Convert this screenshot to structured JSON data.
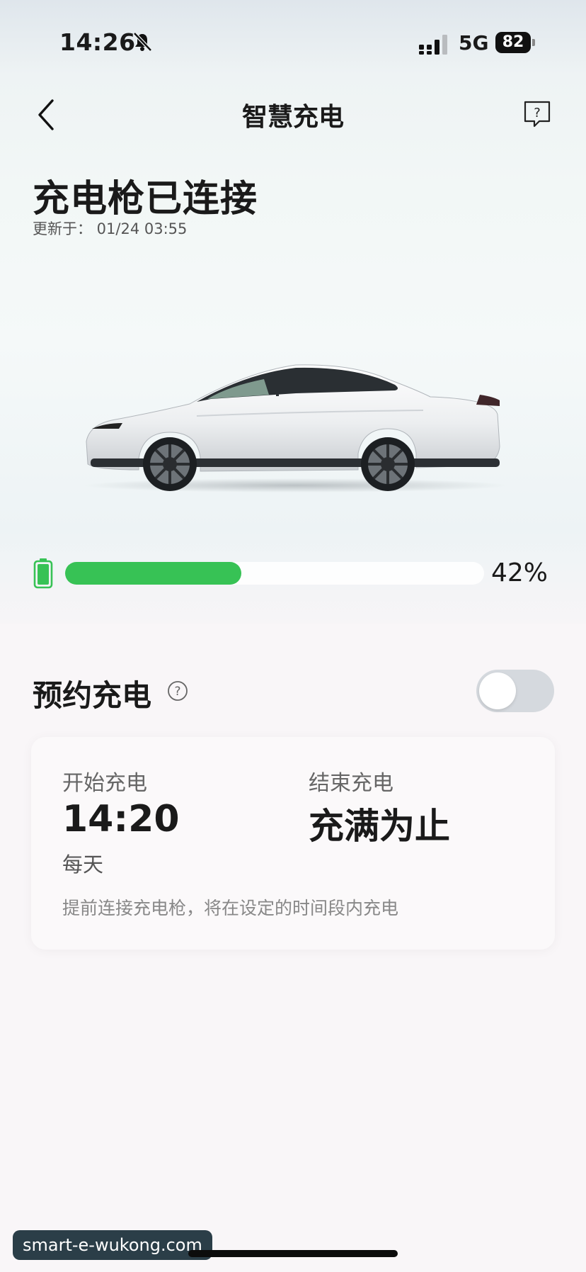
{
  "status_bar": {
    "time": "14:26",
    "network": "5G",
    "battery_level": "82",
    "icons": [
      "bell-off-icon",
      "signal-icon",
      "battery-icon"
    ]
  },
  "nav": {
    "title": "智慧充电",
    "back_icon": "chevron-left-icon",
    "help_icon": "help-question-icon"
  },
  "connection": {
    "status": "充电枪已连接",
    "updated": "更新于：  01/24 03:55"
  },
  "vehicle": {
    "image": "white-sedan-side-view"
  },
  "battery": {
    "percent_text": "42%",
    "percent_value": 0.42,
    "fill_color": "#37c255",
    "icon": "battery-charging-icon"
  },
  "schedule": {
    "label": "预约充电",
    "info_icon": "info-question-icon",
    "toggle_on": false,
    "start_label": "开始充电",
    "start_time": "14:20",
    "repeat": "每天",
    "end_label": "结束充电",
    "end_value": "充满为止",
    "note": "提前连接充电枪，将在设定的时间段内充电"
  },
  "watermark": "smart-e-wukong.com",
  "colors": {
    "accent_green": "#37c255",
    "toggle_off": "#d5d9de"
  }
}
